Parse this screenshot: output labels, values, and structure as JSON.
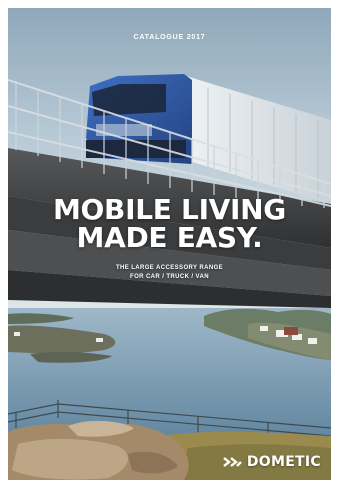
{
  "cover": {
    "catalogue_label": "CATALOGUE 2017",
    "headline": [
      "MOBILE LIVING",
      "MADE EASY."
    ],
    "subheadline": [
      "THE LARGE ACCESSORY RANGE",
      "FOR CAR / TRUCK / VAN"
    ],
    "brand": {
      "name": "DOMETIC",
      "icon": "dometic-chevron-logo-icon"
    },
    "colors": {
      "text": "#ffffff",
      "truck_cab": "#2f58a6",
      "bridge": "#4a4c4e"
    }
  }
}
